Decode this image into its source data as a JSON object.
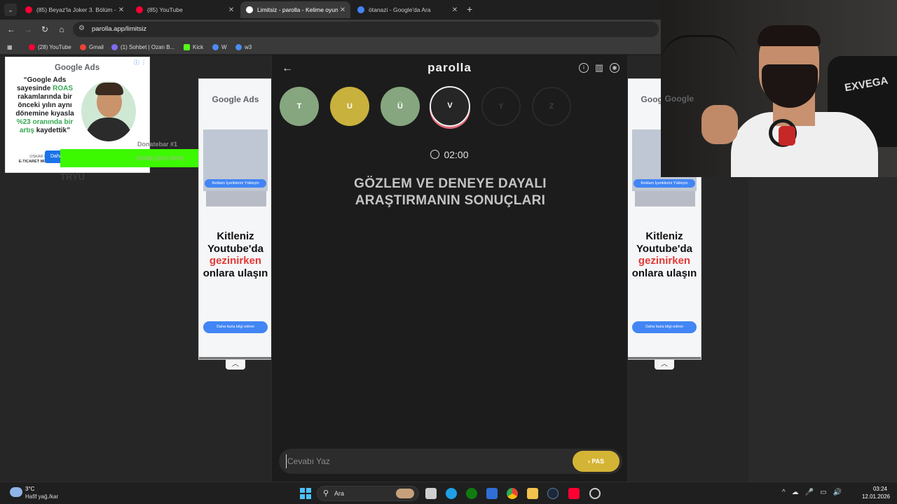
{
  "browser": {
    "tabs": [
      {
        "title": "(85) Beyaz'la Joker 3. Bölüm - Y",
        "favicon_color": "#ff0033",
        "active": false
      },
      {
        "title": "(85) YouTube",
        "favicon_color": "#ff0033",
        "active": false
      },
      {
        "title": "Limitsiz - parolla - Kelime oyun",
        "favicon_color": "#ffffff",
        "active": true
      },
      {
        "title": "ötanazi - Google'da Ara",
        "favicon_color": "#4285f4",
        "active": false
      }
    ],
    "new_tab_label": "+",
    "url": "parolla.app/limitsiz",
    "bookmarks": [
      {
        "label": "(28) YouTube",
        "color": "#ff0033"
      },
      {
        "label": "Gmail",
        "color": "#ea4335"
      },
      {
        "label": "(1) Sohbet | Ozan B...",
        "color": "#7c6cf0"
      },
      {
        "label": "Kick",
        "color": "#53fc18"
      },
      {
        "label": "W",
        "color": "#4c8bf5"
      },
      {
        "label": "w3",
        "color": "#4c8bf5"
      }
    ]
  },
  "ads": {
    "top_left": {
      "brand": "Google Ads",
      "quote_part1": "“Google Ads sayesinde ",
      "quote_roas": "ROAS",
      "quote_part2": " rakamlarında bir önceki yılın aynı dönemine kıyasla ",
      "quote_pct": "%23 oranında bir artış",
      "quote_part3": " kaydettik”",
      "credit_name": "OSKAR LIPINSKI",
      "credit_title": "E-TICARET MÜDÜRÜ, DAAG",
      "cta": "Daha"
    },
    "side": {
      "brand": "Google Ads",
      "chip": "Reklam İçeriklerini Yükleyin",
      "headline1": "Kitleniz",
      "headline2": "Youtube'da",
      "headline_red": "gezinirken",
      "headline3": "onlara ulaşın",
      "cta": "Daha fazla bilgi edinin"
    }
  },
  "overlay": {
    "donate_label": "Donatebar #1",
    "donate_text": "1000₺ (100.00%)",
    "donate_progress": 1.0,
    "tryu": "TRYU"
  },
  "game": {
    "logo": "parolla",
    "letters": [
      {
        "char": "T",
        "state": "correct"
      },
      {
        "char": "U",
        "state": "passed"
      },
      {
        "char": "Ü",
        "state": "correct"
      },
      {
        "char": "V",
        "state": "current"
      },
      {
        "char": "Y",
        "state": "empty"
      },
      {
        "char": "Z",
        "state": "empty"
      }
    ],
    "timer": "02:00",
    "clue_line1": "GÖZLEM VE DENEYE DAYALI",
    "clue_line2": "ARAŞTIRMANIN SONUÇLARI",
    "answer_placeholder": "Cevabı Yaz",
    "pass_label": "PAS"
  },
  "webcam": {
    "chair_text": "EXVEGA",
    "brand_peek": "Google"
  },
  "taskbar": {
    "temperature": "3°C",
    "weather": "Hafif yağ./kar",
    "search_label": "Ara",
    "time": "03:24",
    "date": "12.01.2026"
  }
}
